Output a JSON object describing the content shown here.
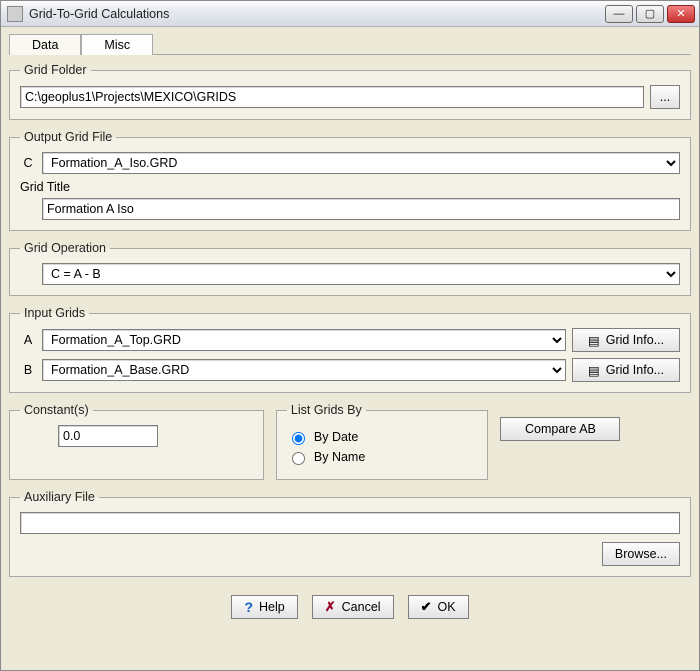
{
  "window": {
    "title": "Grid-To-Grid Calculations"
  },
  "tabs": {
    "data": "Data",
    "misc": "Misc"
  },
  "gridFolder": {
    "legend": "Grid Folder",
    "path": "C:\\geoplus1\\Projects\\MEXICO\\GRIDS",
    "browse": "..."
  },
  "outputGridFile": {
    "legend": "Output Grid File",
    "letter": "C",
    "file": "Formation_A_Iso.GRD",
    "titleLabel": "Grid Title",
    "title": "Formation A Iso"
  },
  "gridOperation": {
    "legend": "Grid Operation",
    "expr": "C = A - B"
  },
  "inputGrids": {
    "legend": "Input Grids",
    "aLetter": "A",
    "aFile": "Formation_A_Top.GRD",
    "bLetter": "B",
    "bFile": "Formation_A_Base.GRD",
    "gridInfo": "Grid Info..."
  },
  "constants": {
    "legend": "Constant(s)",
    "value": "0.0"
  },
  "listGridsBy": {
    "legend": "List Grids By",
    "byDate": "By Date",
    "byName": "By Name"
  },
  "compare": {
    "label": "Compare AB"
  },
  "auxFile": {
    "legend": "Auxiliary File",
    "value": "",
    "browse": "Browse..."
  },
  "footer": {
    "help": "Help",
    "cancel": "Cancel",
    "ok": "OK"
  }
}
